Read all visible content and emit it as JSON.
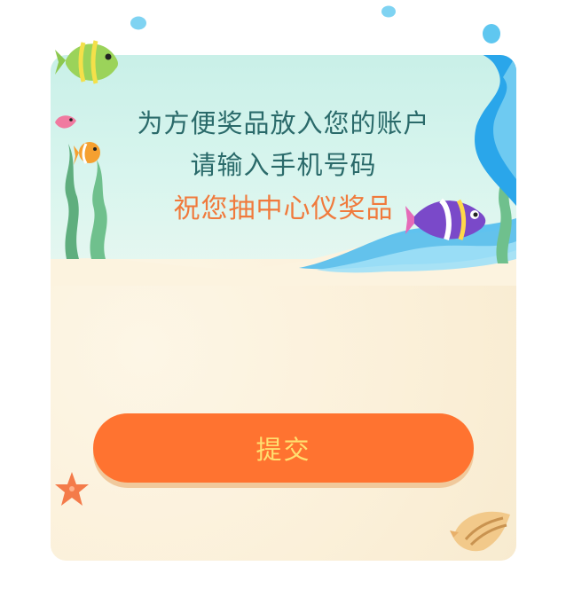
{
  "prompt": {
    "line1": "为方便奖品放入您的账户",
    "line2": "请输入手机号码",
    "line3": "祝您抽中心仪奖品"
  },
  "actions": {
    "submit_label": "提交"
  },
  "colors": {
    "text_primary": "#2a6a6a",
    "text_highlight": "#f07a3c",
    "button_bg": "#ff7330",
    "button_text": "#ffe070",
    "sea": "#c9f0e8",
    "sand": "#fcf3df"
  },
  "icons": [
    "water-drop-icon",
    "tropical-fish-icon",
    "clownfish-icon",
    "angelfish-icon",
    "seaweed-icon",
    "wave-splash-icon",
    "starfish-icon",
    "seashell-icon"
  ]
}
